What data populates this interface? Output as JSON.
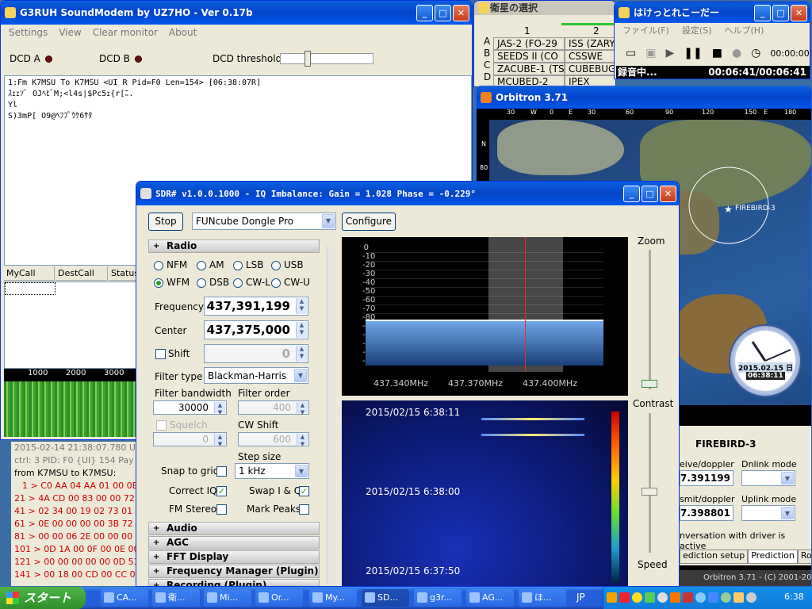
{
  "soundmodem": {
    "title": "G3RUH SoundModem by UZ7HO - Ver 0.17b",
    "menu": [
      "Settings",
      "View",
      "Clear monitor",
      "About"
    ],
    "dcd_a": "DCD A",
    "dcd_b": "DCD B",
    "dcd_threshold": "DCD threshold",
    "monitor": [
      "1:Fm K7MSU To K7MSU <UI R Pid=F0 Len=154> [06:38:07R]",
      "ｽｪｪｿﾞ OJﾍﾋﾞM;<l4s|$Pc5ｪ{r[ﾆ.",
      "Yl",
      "S)3mP[ O9@ﾍﾌﾌﾟｳｹ6ｻﾀ"
    ],
    "cols": [
      "MyCall",
      "DestCall",
      "Status"
    ],
    "freq_marks": [
      "1000",
      "2000",
      "3000"
    ],
    "log": [
      "2015-02-14 21:38:07.780 U",
      "ctrl: 3  PID: F0 {UI}  154 Pay",
      "from K7MSU to K7MSU:",
      "1 > C0 AA 04 AA 01 00 0E",
      "21 > 4A CD 00 83 00 00 72",
      "41 > 02 34 00 19 02 73 01",
      "61 > 0E 00 00 00 00 3B 72",
      "81 > 00 00 06 2E 00 00 00",
      "101 > 0D 1A 00 0F 00 0E 00",
      "121 > 00 00 00 00 00 0D 53 00",
      "141 > 00 18 00 CD 00 CC 0"
    ]
  },
  "satsel": {
    "title": "衛星の選択",
    "cols": [
      "1",
      "2"
    ],
    "letters": [
      "A",
      "B",
      "C",
      "D"
    ],
    "rows": [
      [
        "JAS-2 (FO-29",
        "ISS (ZARY"
      ],
      [
        "SEEDS II (CO",
        "CSSWE"
      ],
      [
        "ZACUBE-1 (TS",
        "CUBEBUG-"
      ],
      [
        "MCUBED-2",
        "IPEX"
      ]
    ]
  },
  "recorder": {
    "title": "はけっとれこーだー",
    "menu": [
      "ファイル(F)",
      "設定(S)",
      "ヘルプ(H)"
    ],
    "timer": "00:00:00",
    "status": "録音中...",
    "elapsed": "00:06:41/00:06:41"
  },
  "orbitron": {
    "title": "Orbitron 3.71",
    "lon_ticks": [
      "30",
      "W",
      "0",
      "E",
      "30",
      "60",
      "90",
      "120",
      "150",
      "E",
      "180"
    ],
    "lat_ticks": [
      "N",
      "80"
    ],
    "sat_label": "FIREBIRD-3",
    "clock_date": "2015.02.15 日",
    "clock_time": "06:38:11",
    "panel_title": "FIREBIRD-3",
    "rx_label": "eive/doppler",
    "rx_val": "7.391199",
    "dn_label": "Dnlink mode",
    "tx_label": "smit/doppler",
    "tx_val": "7.398801",
    "up_label": "Uplink mode",
    "driver_msg": "nversation with driver is active",
    "tabs": [
      "ediction setup",
      "Prediction",
      "Rotor/F"
    ],
    "footer": "Orbitron 3.71 - (C) 2001-2005"
  },
  "sdr": {
    "title": "SDR# v1.0.0.1000 - IQ Imbalance: Gain = 1.028 Phase = -0.229°",
    "stop": "Stop",
    "device": "FUNcube Dongle Pro",
    "configure": "Configure",
    "radio": "Radio",
    "modes": [
      "NFM",
      "AM",
      "LSB",
      "USB",
      "WFM",
      "DSB",
      "CW-L",
      "CW-U"
    ],
    "frequency_label": "Frequency",
    "frequency": "437,391,199",
    "center_label": "Center",
    "center": "437,375,000",
    "shift_label": "Shift",
    "shift": "0",
    "filter_type_label": "Filter type",
    "filter_type": "Blackman-Harris",
    "fbw_label": "Filter bandwidth",
    "fbw": "30000",
    "forder_label": "Filter order",
    "forder": "400",
    "squelch": "Squelch",
    "sq_val": "0",
    "cwshift_label": "CW Shift",
    "cwshift": "600",
    "step_label": "Step size",
    "step": "1 kHz",
    "snap": "Snap to grid",
    "correct_iq": "Correct IQ",
    "swap": "Swap I & Q",
    "fm_stereo": "FM Stereo",
    "mark_peaks": "Mark Peaks",
    "sections": [
      "Audio",
      "AGC",
      "FFT Display",
      "Frequency Manager (Plugin)",
      "Recording (Plugin)"
    ],
    "db_ticks": [
      "0",
      "-10",
      "-20",
      "-30",
      "-40",
      "-50",
      "-60",
      "-70",
      "-80",
      "-90",
      "-100",
      "-110",
      "-120",
      "-130"
    ],
    "freq_ticks": [
      "437.340MHz",
      "437.370MHz",
      "437.400MHz"
    ],
    "wf_times": [
      "2015/02/15 6:38:11",
      "2015/02/15 6:38:00",
      "2015/02/15 6:37:50"
    ],
    "zoom": "Zoom",
    "contrast": "Contrast",
    "speed": "Speed"
  },
  "taskbar": {
    "start": "スタート",
    "items": [
      "CA...",
      "衛...",
      "Mi...",
      "Or...",
      "My...",
      "SD...",
      "g3r...",
      "AG...",
      "ほ..."
    ],
    "lang": "JP",
    "clock": "6:38"
  }
}
